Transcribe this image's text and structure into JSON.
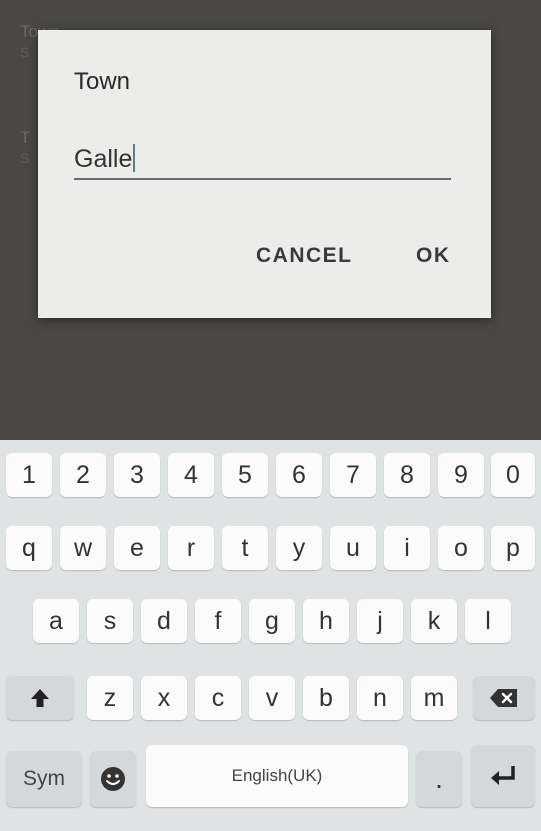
{
  "background_list": [
    {
      "title": "Town",
      "subtitle": "S"
    },
    {
      "title": "T",
      "subtitle": "S"
    }
  ],
  "dialog": {
    "title": "Town",
    "input_value": "Galle",
    "cancel_label": "CANCEL",
    "ok_label": "OK"
  },
  "keyboard": {
    "row_numbers": [
      "1",
      "2",
      "3",
      "4",
      "5",
      "6",
      "7",
      "8",
      "9",
      "0"
    ],
    "row_1": [
      "q",
      "w",
      "e",
      "r",
      "t",
      "y",
      "u",
      "i",
      "o",
      "p"
    ],
    "row_2": [
      "a",
      "s",
      "d",
      "f",
      "g",
      "h",
      "j",
      "k",
      "l"
    ],
    "row_3": [
      "z",
      "x",
      "c",
      "v",
      "b",
      "n",
      "m"
    ],
    "sym_label": "Sym",
    "space_label": "English(UK)",
    "period_label": ".",
    "shift_icon": "shift-arrow-icon",
    "backspace_icon": "backspace-icon",
    "emoji_icon": "emoji-smiley-icon",
    "enter_icon": "enter-return-icon"
  },
  "colors": {
    "dialog_bg": "#ececea",
    "scrim": "#4a4843",
    "keyboard_bg": "#dfe3e4",
    "key_bg": "#fbfbfb",
    "input_underline": "#5d6e70"
  }
}
